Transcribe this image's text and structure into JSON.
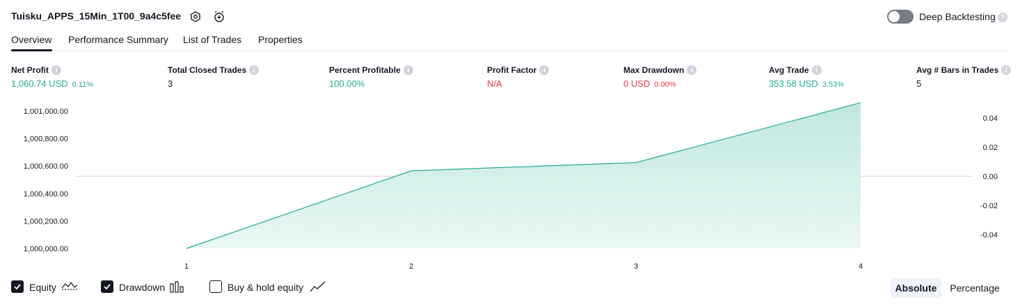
{
  "header": {
    "strategy_name": "Tuisku_APPS_15Min_1T00_9a4c5fee",
    "settings_icon": "gear-icon",
    "alert_icon": "alarm-clock-plus-icon",
    "deep_backtesting_label": "Deep Backtesting",
    "deep_backtesting_enabled": false
  },
  "tabs": [
    {
      "label": "Overview",
      "active": true
    },
    {
      "label": "Performance Summary",
      "active": false
    },
    {
      "label": "List of Trades",
      "active": false
    },
    {
      "label": "Properties",
      "active": false
    }
  ],
  "metrics": {
    "net_profit": {
      "label": "Net Profit",
      "value": "1,060.74 USD",
      "pct": "0.11%"
    },
    "total_closed_trades": {
      "label": "Total Closed Trades",
      "value": "3"
    },
    "percent_profitable": {
      "label": "Percent Profitable",
      "value": "100.00%"
    },
    "profit_factor": {
      "label": "Profit Factor",
      "value": "N/A"
    },
    "max_drawdown": {
      "label": "Max Drawdown",
      "value": "0 USD",
      "pct": "0.00%"
    },
    "avg_trade": {
      "label": "Avg Trade",
      "value": "353.58 USD",
      "pct": "3.53%"
    },
    "avg_bars_in_trades": {
      "label": "Avg # Bars in Trades",
      "value": "5"
    }
  },
  "chart_data": {
    "type": "area",
    "x": [
      1,
      2,
      3,
      4
    ],
    "series": [
      {
        "name": "Equity",
        "values": [
          1000000.0,
          1000565.0,
          1000625.0,
          1001060.74
        ]
      }
    ],
    "y_left_ticks": [
      "1,001,000.00",
      "1,000,800.00",
      "1,000,600.00",
      "1,000,400.00",
      "1,000,200.00",
      "1,000,000.00"
    ],
    "y_left_range": [
      1000000,
      1001000
    ],
    "y_right_ticks": [
      "0.04",
      "0.02",
      "0.00",
      "-0.02",
      "-0.04"
    ],
    "y_right_range": [
      -0.04,
      0.04
    ],
    "x_tick_labels": [
      "1",
      "2",
      "3",
      "4"
    ],
    "drawdown_baseline": 0.0,
    "colors": {
      "area_line": "#22ab94",
      "area_fill_top": "#bfe8df",
      "area_fill_bottom": "#eaf7f4",
      "baseline": "#e1bee7"
    }
  },
  "legend": {
    "equity_label": "Equity",
    "equity_checked": true,
    "drawdown_label": "Drawdown",
    "drawdown_checked": true,
    "buy_hold_label": "Buy & hold equity",
    "buy_hold_checked": false
  },
  "view_mode": {
    "absolute_label": "Absolute",
    "percentage_label": "Percentage",
    "selected": "Absolute"
  },
  "colors": {
    "positive": "#22ab94",
    "negative": "#f23645",
    "text": "#131722"
  }
}
